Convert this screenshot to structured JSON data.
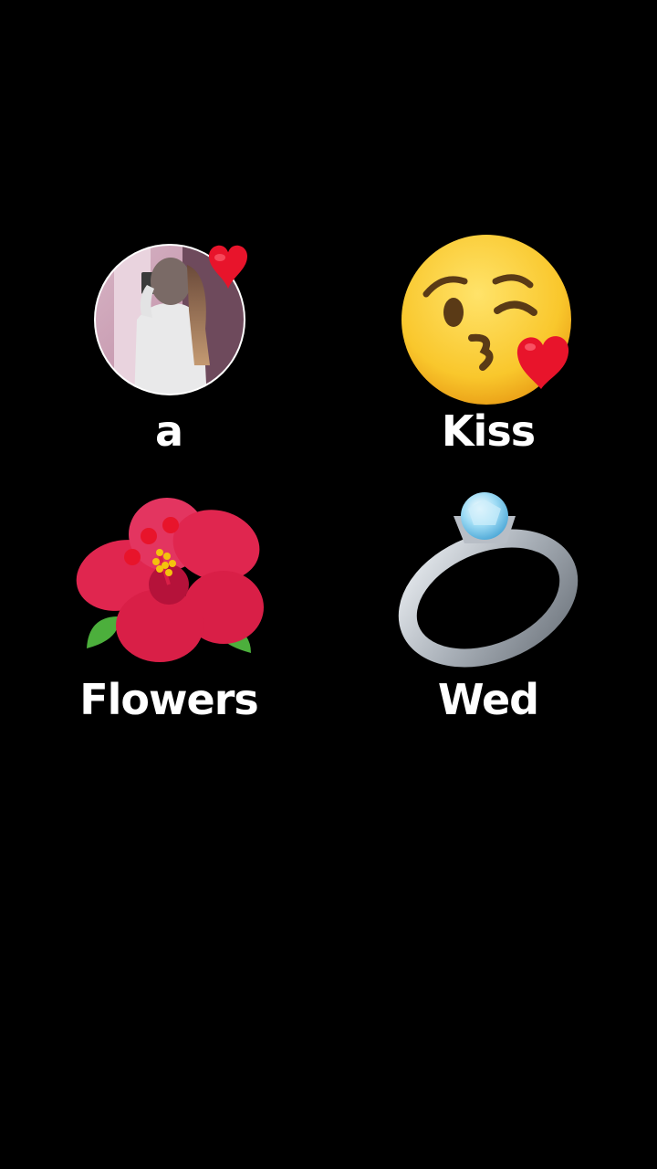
{
  "tiles": [
    {
      "label": "a",
      "icon": "profile-photo-with-heart"
    },
    {
      "label": "Kiss",
      "icon": "face-blowing-kiss-icon"
    },
    {
      "label": "Flowers",
      "icon": "hibiscus-icon"
    },
    {
      "label": "Wed",
      "icon": "ring-icon"
    }
  ],
  "colors": {
    "background": "#000000",
    "text": "#ffffff",
    "heart": "#e8142b",
    "emoji_face": "#f9c72c",
    "flower": "#e0264f",
    "leaf": "#4caf3c",
    "ring_metal": "#b8bec6",
    "diamond": "#9fdcf5"
  }
}
